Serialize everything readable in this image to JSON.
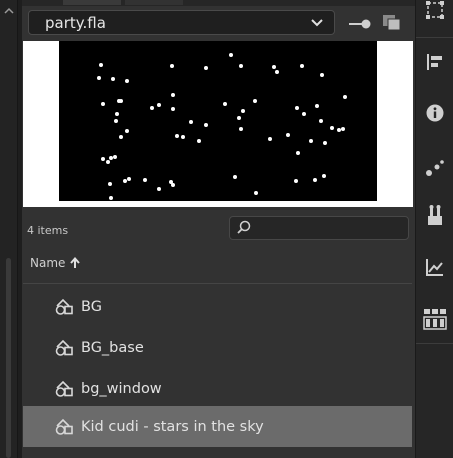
{
  "library": {
    "document_name": "party.fla",
    "items_count_label": "4 items",
    "search": {
      "placeholder": "",
      "value": ""
    },
    "column_header": "Name",
    "sort_direction": "ascending",
    "items": [
      {
        "name": "BG",
        "type": "movie-clip",
        "icon": "symbol-icon",
        "selected": false
      },
      {
        "name": "BG_base",
        "type": "movie-clip",
        "icon": "symbol-icon",
        "selected": false
      },
      {
        "name": "bg_window",
        "type": "movie-clip",
        "icon": "symbol-icon",
        "selected": false
      },
      {
        "name": "Kid cudi - stars in the sky",
        "type": "movie-clip",
        "icon": "symbol-icon",
        "selected": true
      }
    ],
    "preview": {
      "background": "#000000",
      "star_color": "#ffffff"
    }
  },
  "toolbar_right": [
    {
      "icon": "align-icon"
    },
    {
      "icon": "info-icon"
    },
    {
      "icon": "motion-presets-icon"
    },
    {
      "icon": "components-icon"
    },
    {
      "icon": "motion-editor-icon"
    },
    {
      "icon": "swatches-grid-icon"
    }
  ],
  "colors": {
    "panel_bg": "#323232",
    "selected_row": "#6b6b6b",
    "app_bg": "#1e1e1e"
  }
}
